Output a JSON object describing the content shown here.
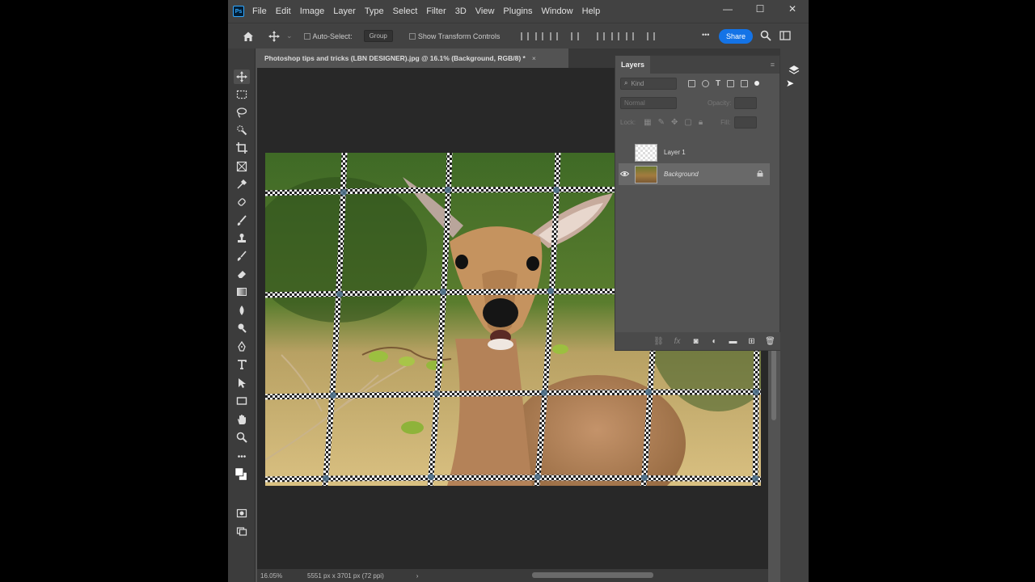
{
  "app": {
    "logo_text": "Ps",
    "menus": [
      "File",
      "Edit",
      "Image",
      "Layer",
      "Type",
      "Select",
      "Filter",
      "3D",
      "View",
      "Plugins",
      "Window",
      "Help"
    ],
    "window_controls": {
      "minimize": "—",
      "maximize": "☐",
      "close": "✕"
    }
  },
  "options_bar": {
    "auto_select_label": "Auto-Select:",
    "auto_select_value": "Group",
    "show_transform_label": "Show Transform Controls",
    "more_label": "•••",
    "share_label": "Share"
  },
  "document": {
    "tab_title": "Photoshop tips and tricks (LBN DESIGNER).jpg @ 16.1% (Background, RGB/8) *",
    "tab_close": "×"
  },
  "status_bar": {
    "zoom": "16.05%",
    "doc_size": "5551 px x 3701 px (72 ppi)",
    "arrow": "›"
  },
  "layers_panel": {
    "tab_label": "Layers",
    "panel_menu": "≡",
    "filter_placeholder": "Kind",
    "blend_mode": "Normal",
    "opacity_label": "Opacity:",
    "lock_label": "Lock:",
    "fill_label": "Fill:",
    "layers": [
      {
        "name": "Layer 1",
        "visible": false,
        "selected": false,
        "locked": false
      },
      {
        "name": "Background",
        "visible": true,
        "selected": true,
        "locked": true
      }
    ]
  },
  "colors": {
    "accent": "#1473e6",
    "panel": "#535353",
    "canvas": "#282828",
    "bar": "#424242"
  },
  "icons": {
    "home": "home-icon",
    "move": "move-icon",
    "search": "search-icon",
    "layers": "layers-icon",
    "eye": "eye-icon",
    "lock": "lock-icon"
  }
}
